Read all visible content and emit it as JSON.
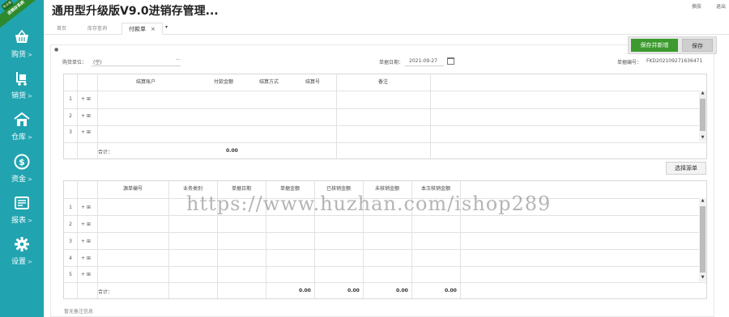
{
  "brand": {
    "badge": "专业版",
    "ribbon": "进销存系统"
  },
  "app": {
    "title": "通用型升级版V9.0进销存管理..."
  },
  "top_links": [
    "换肤",
    "退出"
  ],
  "sidebar": {
    "items": [
      {
        "label": "购货",
        "icon": "basket-icon"
      },
      {
        "label": "销货",
        "icon": "cart-icon"
      },
      {
        "label": "仓库",
        "icon": "warehouse-icon"
      },
      {
        "label": "资金",
        "icon": "dollar-icon"
      },
      {
        "label": "报表",
        "icon": "report-icon"
      },
      {
        "label": "设置",
        "icon": "gear-icon"
      }
    ],
    "chevron": ">",
    "bg_color": "#21a4b0"
  },
  "tabs": [
    {
      "label": "首页",
      "active": false
    },
    {
      "label": "库存查询",
      "active": false
    },
    {
      "label": "付款单",
      "active": true,
      "close": "×"
    }
  ],
  "tab_dropdown": "▾",
  "toolbar": {
    "save_new_label": "保存并新增",
    "save_label": "保存"
  },
  "form": {
    "supplier_label": "购货单位：",
    "supplier_value": "(空)",
    "supplier_more": "···",
    "date_label": "单据日期：",
    "date_value": "2021-09-27",
    "doc_no_label": "单据编号：",
    "doc_no_value": "FKD202109271636471"
  },
  "settle_table": {
    "columns": [
      "结算账户",
      "付款金额",
      "结算方式",
      "结算号",
      "备注"
    ],
    "rows": [
      "1",
      "2",
      "3"
    ],
    "row_actions": "+ ⊞",
    "sum_label": "合计：",
    "sum_amount": "0.00"
  },
  "select_bills_label": "选择源单",
  "source_table": {
    "columns": [
      "源单编号",
      "业务类别",
      "单据日期",
      "单据金额",
      "已核销金额",
      "未核销金额",
      "本次核销金额"
    ],
    "rows": [
      "1",
      "2",
      "3",
      "4",
      "5"
    ],
    "row_actions": "+ ⊞",
    "sum_label": "合计：",
    "sums": [
      "0.00",
      "0.00",
      "0.00",
      "0.00"
    ]
  },
  "footer_note": "暂无备注信息",
  "watermark": "https://www.huzhan.com/ishop289",
  "colors": {
    "accent_green": "#3c9a2e",
    "sidebar": "#21a4b0"
  }
}
